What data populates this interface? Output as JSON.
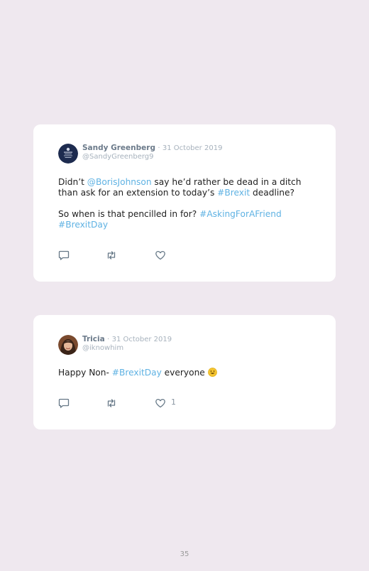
{
  "tweets": [
    {
      "author": "Sandy Greenberg",
      "separator": "·",
      "date": "31 October 2019",
      "handle": "@SandyGreenberg9",
      "avatar": "government-crest-avatar",
      "body": {
        "p1_t1": "Didn’t ",
        "p1_l1": "@BorisJohnson",
        "p1_t2": " say he’d rather be dead in a ditch",
        "p1_t3": "than ask for an extension to today’s ",
        "p1_l2": "#Brexit",
        "p1_t4": " deadline?",
        "p2_t1": "So when is that pencilled in for? ",
        "p2_l1": "#AskingForAFriend",
        "p2_l2": "#BrexitDay"
      },
      "actions": {
        "reply_icon": "reply-icon",
        "retweet_icon": "retweet-icon",
        "like_icon": "heart-icon"
      }
    },
    {
      "author": "Tricia",
      "separator": "·",
      "date": "31 October 2019",
      "handle": "@iknowhim",
      "avatar": "woman-portrait-avatar",
      "body": {
        "t1": "Happy Non- ",
        "l1": "#BrexitDay",
        "t2": " everyone ",
        "emoji": "smiley-emoji"
      },
      "actions": {
        "reply_icon": "reply-icon",
        "retweet_icon": "retweet-icon",
        "like_icon": "heart-icon",
        "like_count": "1"
      }
    }
  ],
  "page_number": "35",
  "colors": {
    "background": "#efe8ef",
    "card": "#ffffff",
    "link": "#5fb2e3",
    "author": "#6b7a8a",
    "muted": "#a7b2bd"
  }
}
